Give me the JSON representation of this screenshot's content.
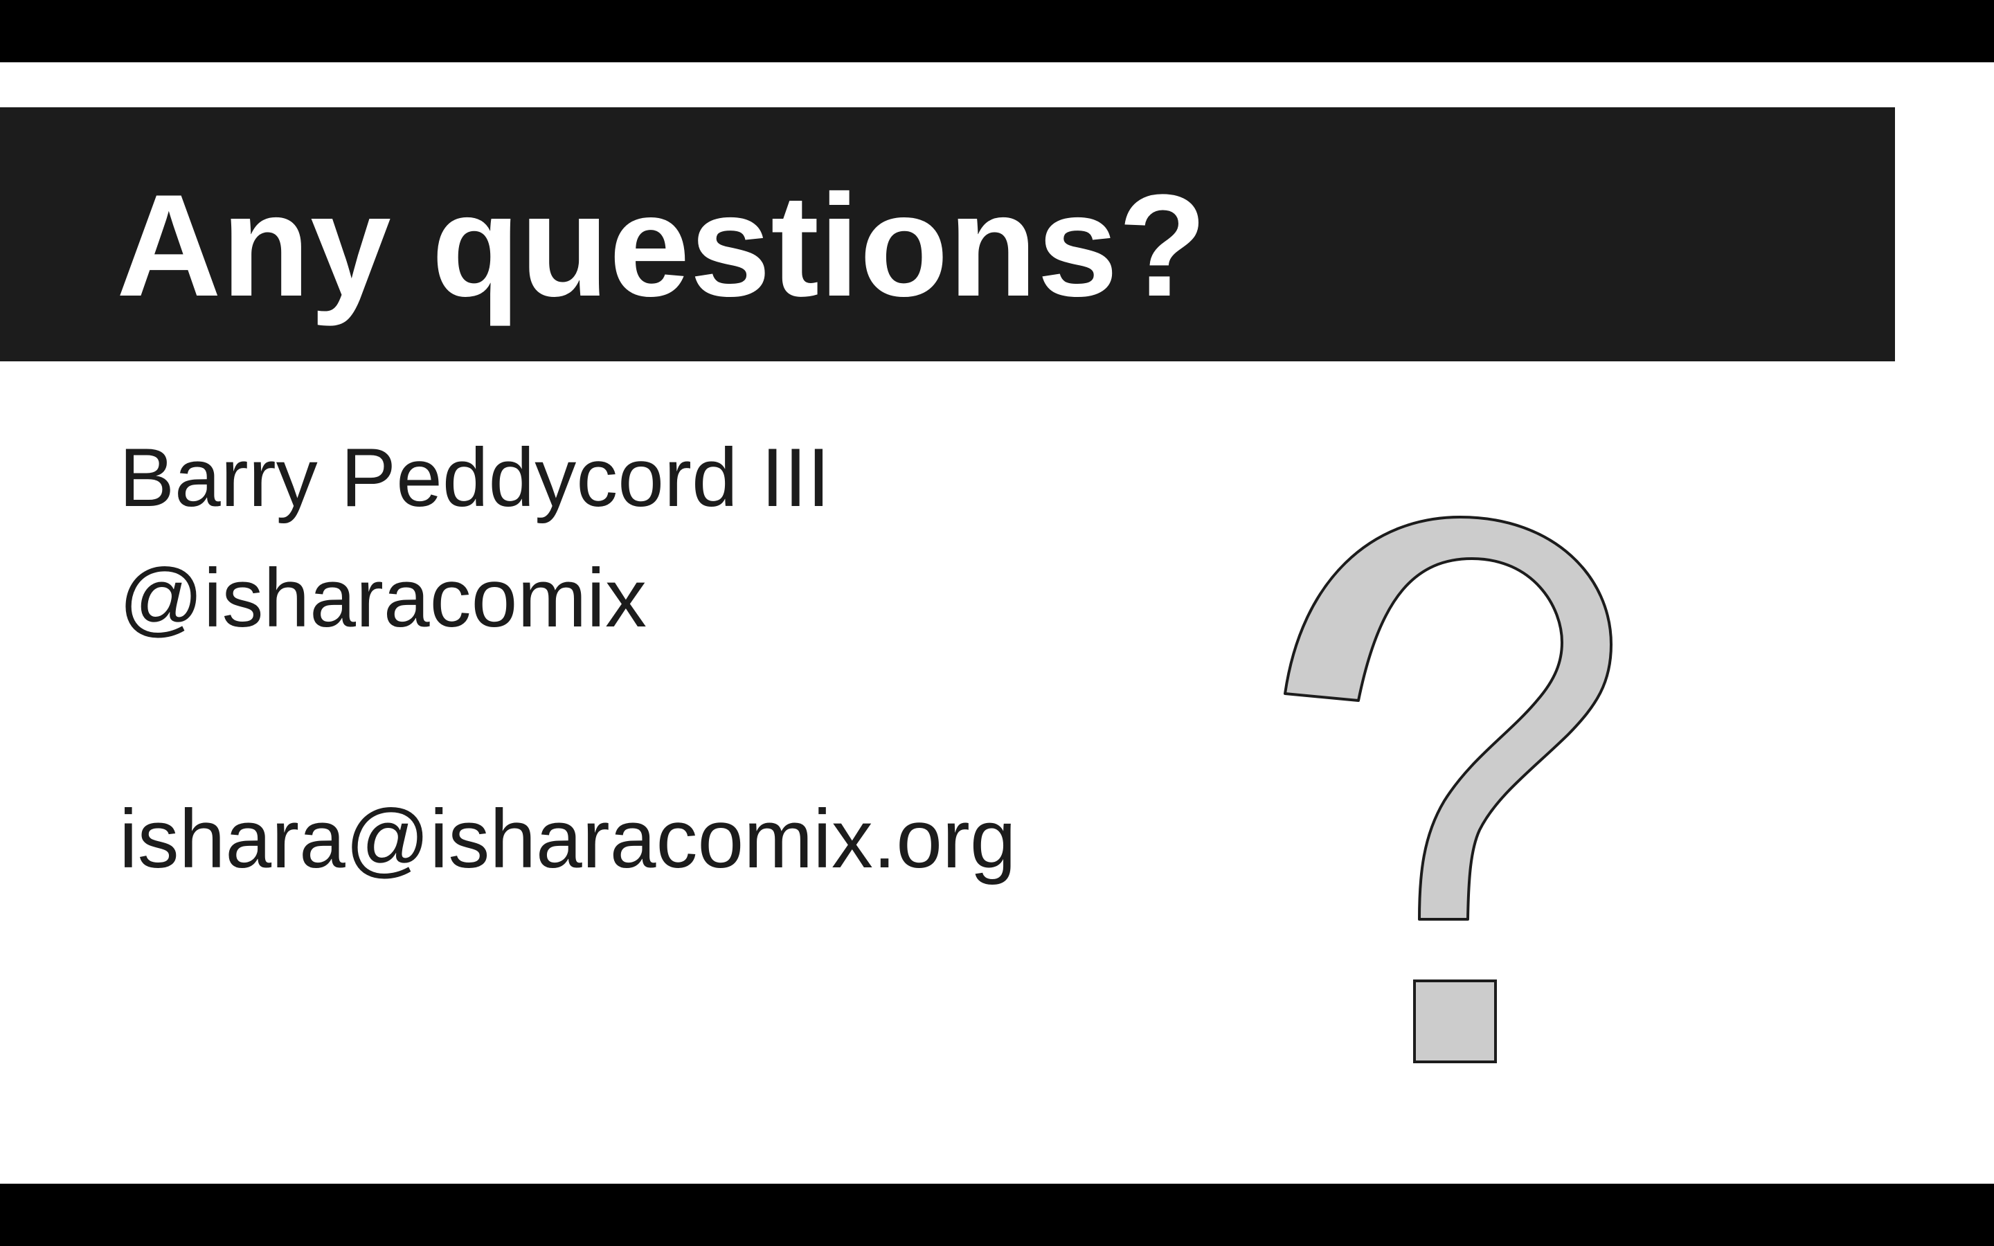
{
  "slide": {
    "title": "Any questions?",
    "lines": [
      "Barry Peddycord III",
      "@isharacomix",
      "",
      "ishara@isharacomix.org"
    ]
  },
  "icons": {
    "question_mark": "question-mark-icon"
  },
  "colors": {
    "title_bar": "#1c1c1c",
    "title_text": "#ffffff",
    "body_text": "#1c1c1c",
    "slide_background": "#ffffff",
    "letterbox": "#000000",
    "question_mark_fill": "#cccccc",
    "question_mark_stroke": "#1c1c1c"
  }
}
